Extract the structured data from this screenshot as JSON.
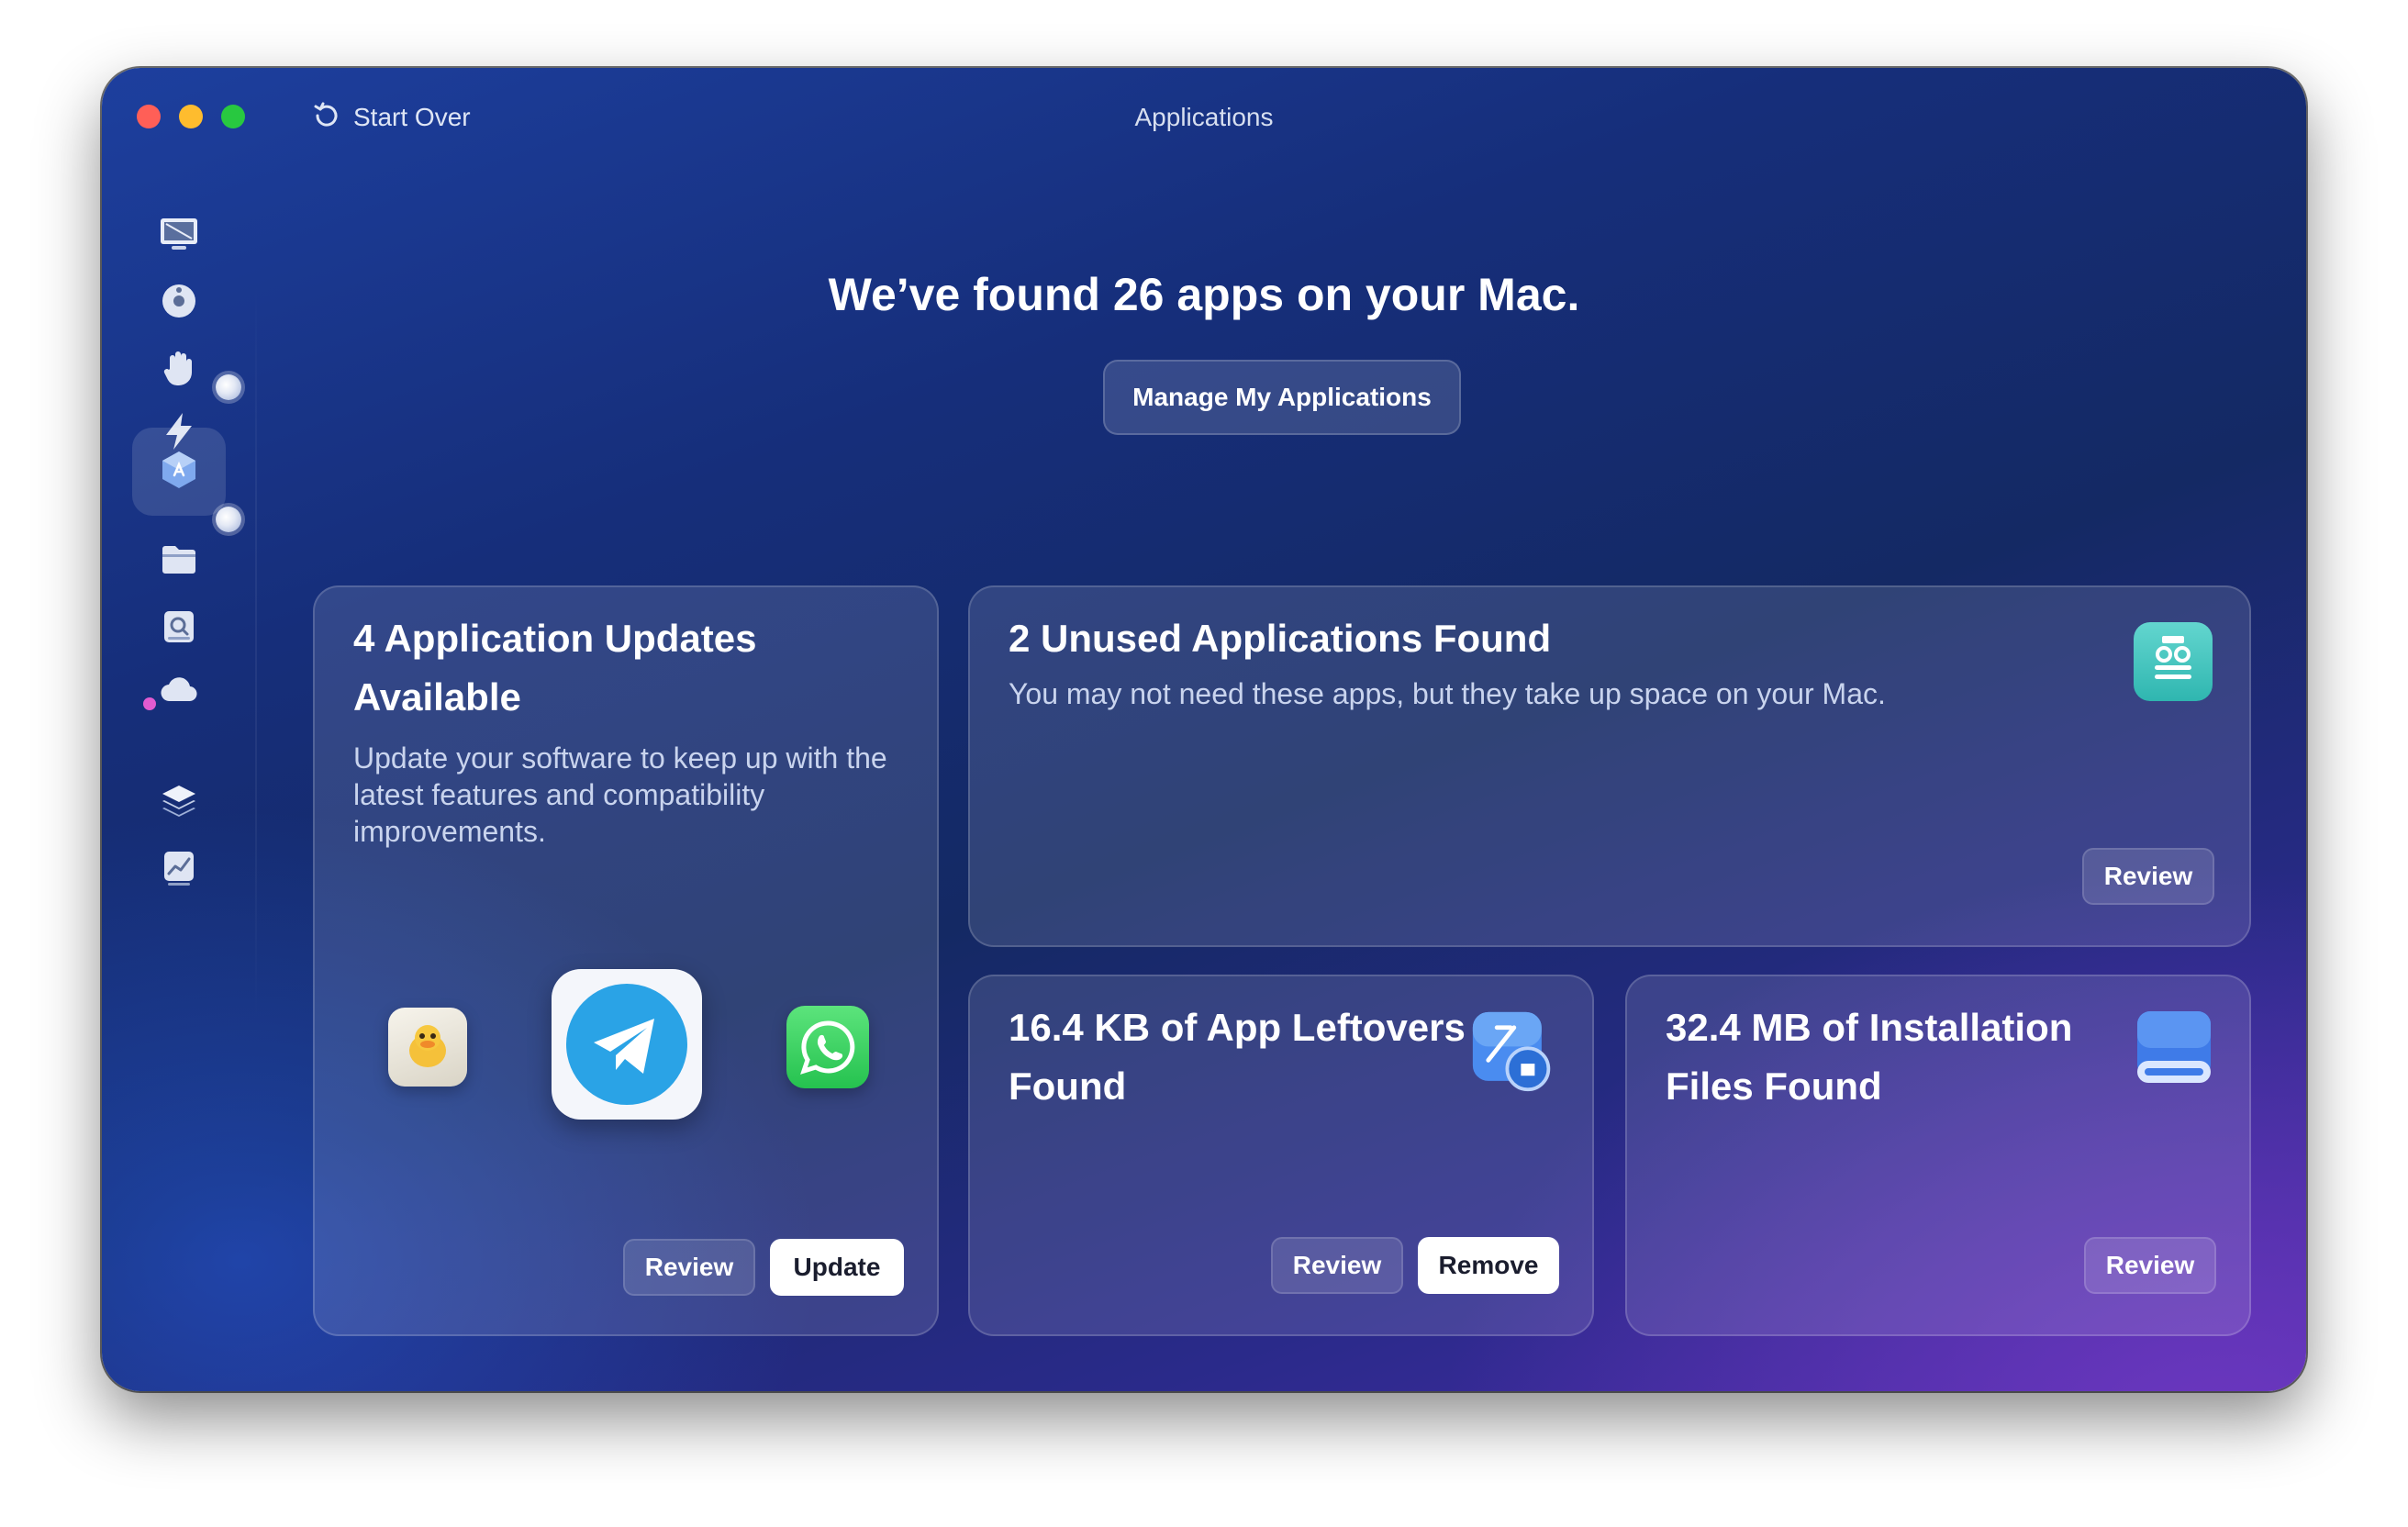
{
  "window": {
    "title": "Applications",
    "start_over_label": "Start Over"
  },
  "sidebar": {
    "items": [
      {
        "name": "system-junk",
        "icon": "monitor-icon"
      },
      {
        "name": "malware",
        "icon": "biohazard-icon"
      },
      {
        "name": "privacy",
        "icon": "hand-icon"
      },
      {
        "name": "speed",
        "icon": "lightning-icon"
      },
      {
        "name": "applications",
        "icon": "app-store-icon",
        "active": true
      },
      {
        "name": "my-clutter",
        "icon": "folder-icon"
      },
      {
        "name": "space-lens",
        "icon": "disk-search-icon"
      },
      {
        "name": "cloud",
        "icon": "cloud-icon"
      },
      {
        "name": "assistant",
        "icon": "layers-icon"
      },
      {
        "name": "performance",
        "icon": "chart-icon"
      }
    ]
  },
  "main": {
    "headline": "We’ve found 26 apps on your Mac.",
    "manage_button": "Manage My Applications"
  },
  "cards": {
    "updates": {
      "title_line1": "4 Application Updates",
      "title_line2": "Available",
      "description": "Update your software to keep up with the latest features and compatibility improvements.",
      "apps": [
        "duck-app-icon",
        "telegram-icon",
        "whatsapp-icon"
      ],
      "review_label": "Review",
      "update_label": "Update"
    },
    "unused": {
      "title": "2 Unused Applications Found",
      "description": "You may not need these apps, but they take up space on your Mac.",
      "icon": "robot-icon",
      "review_label": "Review"
    },
    "leftovers": {
      "title_line1": "16.4 KB of App Leftovers",
      "title_line2": "Found",
      "icon": "leftovers-icon",
      "review_label": "Review",
      "remove_label": "Remove"
    },
    "installation": {
      "title_line1": "32.4 MB of Installation",
      "title_line2": "Files Found",
      "icon": "drive-icon",
      "review_label": "Review"
    }
  },
  "colors": {
    "traffic_red": "#ff5f57",
    "traffic_yellow": "#febc2e",
    "traffic_green": "#28c840",
    "accent_pink": "#e25bd0",
    "telegram_blue": "#2aa3e6",
    "whatsapp_green": "#2fce5a"
  }
}
